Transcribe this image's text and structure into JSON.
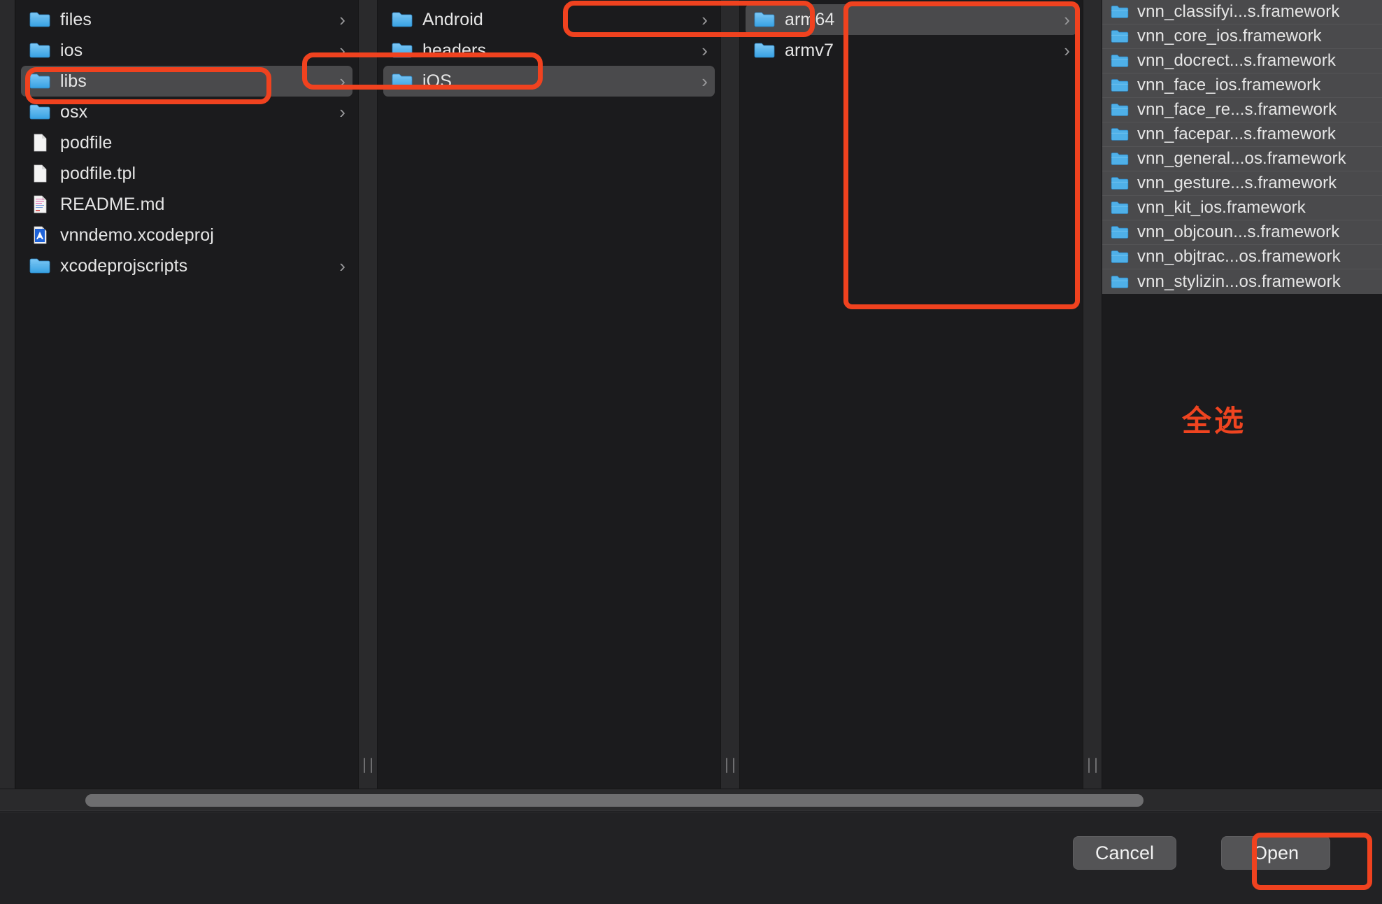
{
  "window": {
    "kind": "macos-open-file-dialog",
    "view_mode": "column-view",
    "background_color": "#1b1b1d",
    "highlight_color": "#f0421f",
    "selection_color": "#4a4a4c"
  },
  "columns": [
    {
      "name": "column-1-project-root",
      "items": [
        {
          "label": "files",
          "icon": "folder-icon",
          "chevron": "›",
          "selected": false
        },
        {
          "label": "ios",
          "icon": "folder-icon",
          "chevron": "›",
          "selected": false
        },
        {
          "label": "libs",
          "icon": "folder-icon",
          "chevron": "›",
          "selected": true
        },
        {
          "label": "osx",
          "icon": "folder-icon",
          "chevron": "›",
          "selected": false
        },
        {
          "label": "podfile",
          "icon": "document-icon",
          "chevron": "",
          "selected": false
        },
        {
          "label": "podfile.tpl",
          "icon": "document-icon",
          "chevron": "",
          "selected": false
        },
        {
          "label": "README.md",
          "icon": "markdown-file-icon",
          "chevron": "",
          "selected": false
        },
        {
          "label": "vnndemo.xcodeproj",
          "icon": "xcodeproj-file-icon",
          "chevron": "",
          "selected": false
        },
        {
          "label": "xcodeprojscripts",
          "icon": "folder-icon",
          "chevron": "›",
          "selected": false
        }
      ]
    },
    {
      "name": "column-2-libs",
      "items": [
        {
          "label": "Android",
          "icon": "folder-icon",
          "chevron": "›",
          "selected": false
        },
        {
          "label": "headers",
          "icon": "folder-icon",
          "chevron": "›",
          "selected": false
        },
        {
          "label": "iOS",
          "icon": "folder-icon",
          "chevron": "›",
          "selected": true
        }
      ]
    },
    {
      "name": "column-3-ios",
      "items": [
        {
          "label": "arm64",
          "icon": "folder-icon",
          "chevron": "›",
          "selected": true
        },
        {
          "label": "armv7",
          "icon": "folder-icon",
          "chevron": "›",
          "selected": false
        }
      ]
    },
    {
      "name": "column-4-arm64-frameworks",
      "items": [
        {
          "label": "vnn_classifyi...s.framework",
          "icon": "folder-icon",
          "chevron": "›",
          "selected": true
        },
        {
          "label": "vnn_core_ios.framework",
          "icon": "folder-icon",
          "chevron": "›",
          "selected": true
        },
        {
          "label": "vnn_docrect...s.framework",
          "icon": "folder-icon",
          "chevron": "›",
          "selected": true
        },
        {
          "label": "vnn_face_ios.framework",
          "icon": "folder-icon",
          "chevron": "›",
          "selected": true
        },
        {
          "label": "vnn_face_re...s.framework",
          "icon": "folder-icon",
          "chevron": "›",
          "selected": true
        },
        {
          "label": "vnn_facepar...s.framework",
          "icon": "folder-icon",
          "chevron": "›",
          "selected": true
        },
        {
          "label": "vnn_general...os.framework",
          "icon": "folder-icon",
          "chevron": "›",
          "selected": true
        },
        {
          "label": "vnn_gesture...s.framework",
          "icon": "folder-icon",
          "chevron": "›",
          "selected": true
        },
        {
          "label": "vnn_kit_ios.framework",
          "icon": "folder-icon",
          "chevron": "›",
          "selected": true
        },
        {
          "label": "vnn_objcoun...s.framework",
          "icon": "folder-icon",
          "chevron": "›",
          "selected": true
        },
        {
          "label": "vnn_objtrac...os.framework",
          "icon": "folder-icon",
          "chevron": "›",
          "selected": true
        },
        {
          "label": "vnn_stylizin...os.framework",
          "icon": "folder-icon",
          "chevron": "›",
          "selected": true
        }
      ]
    }
  ],
  "annotation": {
    "text": "全选",
    "color": "#ef4420"
  },
  "scrollbar": {
    "orientation": "horizontal"
  },
  "footer": {
    "cancel_label": "Cancel",
    "open_label": "Open"
  }
}
